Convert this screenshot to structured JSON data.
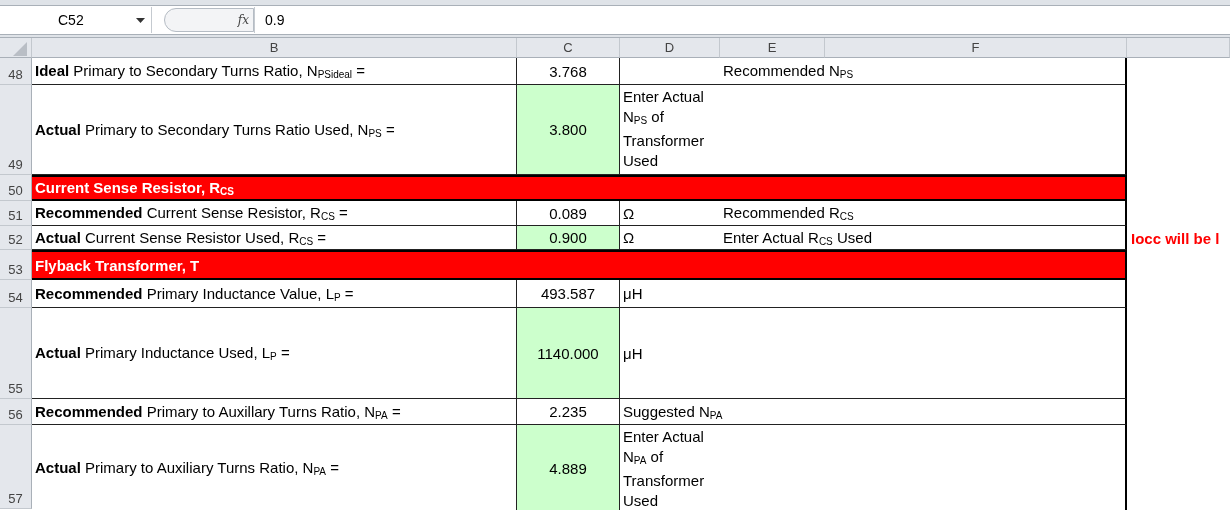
{
  "formula_bar": {
    "name_box": "C52",
    "formula": "0.9",
    "function_label": "fx"
  },
  "columns": [
    "B",
    "C",
    "D",
    "E",
    "F"
  ],
  "rows": [
    {
      "number": "48",
      "kind": "data",
      "label": "**Ideal** Primary to Secondary Turns Ratio, N$_{PSideal}$ =",
      "value": "3.768",
      "editable": false,
      "col_e": "Recommended N$_{PS}$"
    },
    {
      "number": "49",
      "kind": "data",
      "label": "**Actual** Primary to Secondary Turns Ratio Used, N$_{PS}$  =",
      "value": "3.800",
      "editable": true,
      "col_d": "Enter Actual N$_{PS}$ of Transformer Used"
    },
    {
      "number": "50",
      "kind": "section",
      "label": "Current Sense Resistor, R$_{CS}$"
    },
    {
      "number": "51",
      "kind": "data",
      "label": "**Recommended** Current Sense Resistor, R$_{CS}$ =",
      "value": "0.089",
      "editable": false,
      "col_d": "Ω",
      "col_e": "Recommended R$_{CS}$"
    },
    {
      "number": "52",
      "kind": "data",
      "label": "**Actual** Current Sense Resistor Used, R$_{CS}$ =",
      "value": "0.900",
      "editable": true,
      "col_d": "Ω",
      "col_e": "Enter Actual R$_{CS}$ Used",
      "note": "Iocc will be l"
    },
    {
      "number": "53",
      "kind": "section",
      "label": "Flyback Transformer, T"
    },
    {
      "number": "54",
      "kind": "data",
      "label": "**Recommended** Primary Inductance Value, L$_{P}$ =",
      "value": "493.587",
      "editable": false,
      "col_d": "μH"
    },
    {
      "number": "55",
      "kind": "data",
      "label": "**Actual** Primary Inductance Used, L$_{P}$ =",
      "value": "1140.000",
      "editable": true,
      "col_d": "μH"
    },
    {
      "number": "56",
      "kind": "data",
      "label": "**Recommended** Primary to Auxillary Turns Ratio, N$_{PA}$ =",
      "value": "2.235",
      "editable": false,
      "col_d": "Suggested N$_{PA}$"
    },
    {
      "number": "57",
      "kind": "data",
      "label": "**Actual** Primary to Auxiliary Turns Ratio, N$_{PA}$ =",
      "value": "4.889",
      "editable": true,
      "col_d": "Enter Actual N$_{PA}$ of Transformer Used"
    }
  ]
}
